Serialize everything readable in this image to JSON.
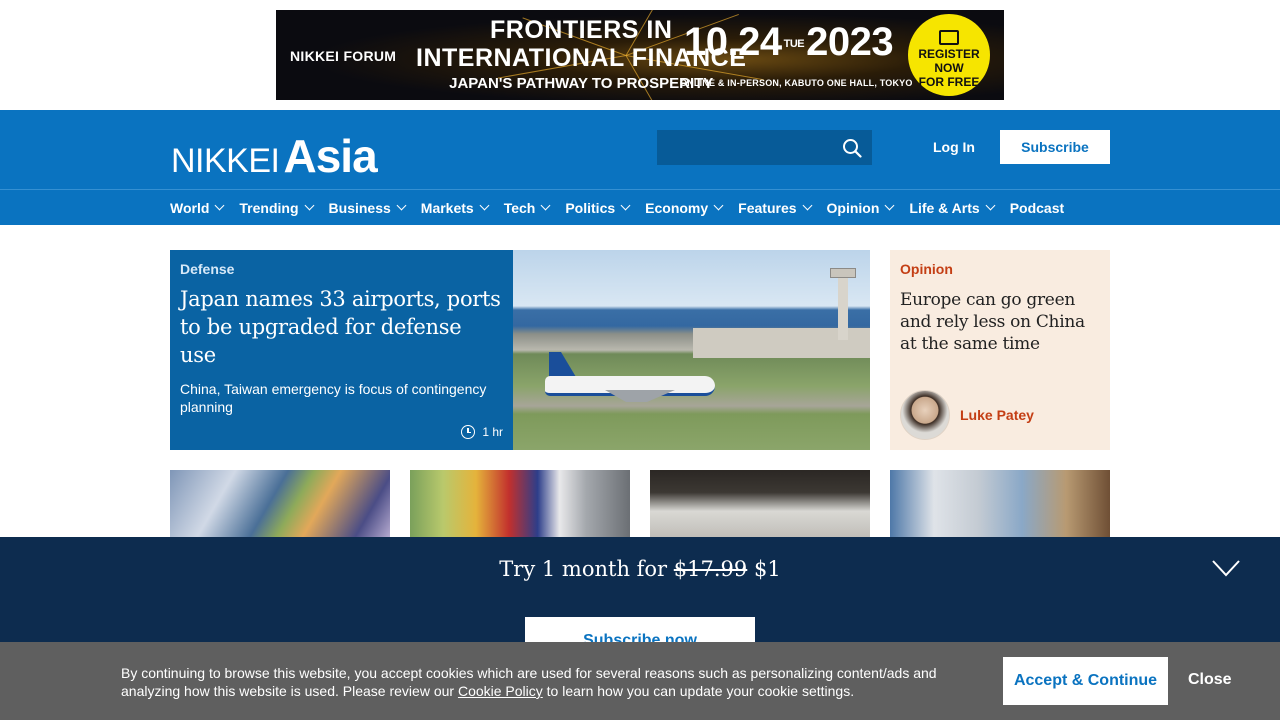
{
  "ad": {
    "brand": "NIKKEI FORUM",
    "title_line1": "FRONTIERS IN",
    "title_line2": "INTERNATIONAL FINANCE",
    "title_line3": "JAPAN'S PATHWAY TO PROSPERITY",
    "date_start": "10.24",
    "day": "TUE",
    "year": "2023",
    "venue": "ONLINE & IN-PERSON, KABUTO ONE HALL, TOKYO",
    "cta_line1": "REGISTER NOW",
    "cta_line2": "FOR FREE",
    "accent_color": "#f6e500"
  },
  "header": {
    "logo_nikkei": "NIKKEI",
    "logo_asia": "Asia",
    "search_placeholder": "",
    "login_label": "Log In",
    "subscribe_label": "Subscribe",
    "brand_color": "#0a73c0"
  },
  "nav": {
    "items": [
      {
        "label": "World",
        "dropdown": true
      },
      {
        "label": "Trending",
        "dropdown": true
      },
      {
        "label": "Business",
        "dropdown": true
      },
      {
        "label": "Markets",
        "dropdown": true
      },
      {
        "label": "Tech",
        "dropdown": true
      },
      {
        "label": "Politics",
        "dropdown": true
      },
      {
        "label": "Economy",
        "dropdown": true
      },
      {
        "label": "Features",
        "dropdown": true
      },
      {
        "label": "Opinion",
        "dropdown": true
      },
      {
        "label": "Life & Arts",
        "dropdown": true
      },
      {
        "label": "Podcast",
        "dropdown": false
      }
    ]
  },
  "hero": {
    "tag": "Defense",
    "title": "Japan names 33 airports, ports to be upgraded for defense use",
    "subtitle": "China, Taiwan emergency is focus of contingency planning",
    "time": "1 hr"
  },
  "opinion": {
    "tag": "Opinion",
    "title": "Europe can go green and rely less on China at the same time",
    "author": "Luke Patey"
  },
  "promo": {
    "text_prefix": "Try 1 month for",
    "old_price": "$17.99",
    "new_price": "$1",
    "button_label": "Subscribe now"
  },
  "cookie": {
    "text_before": "By continuing to browse this website, you accept cookies which are used for several reasons such as personalizing content/ads and analyzing how this website is used. Please review our",
    "link_text": "Cookie Policy",
    "text_after": "to learn how you can update your cookie settings.",
    "accept_label": "Accept & Continue",
    "close_label": "Close"
  }
}
